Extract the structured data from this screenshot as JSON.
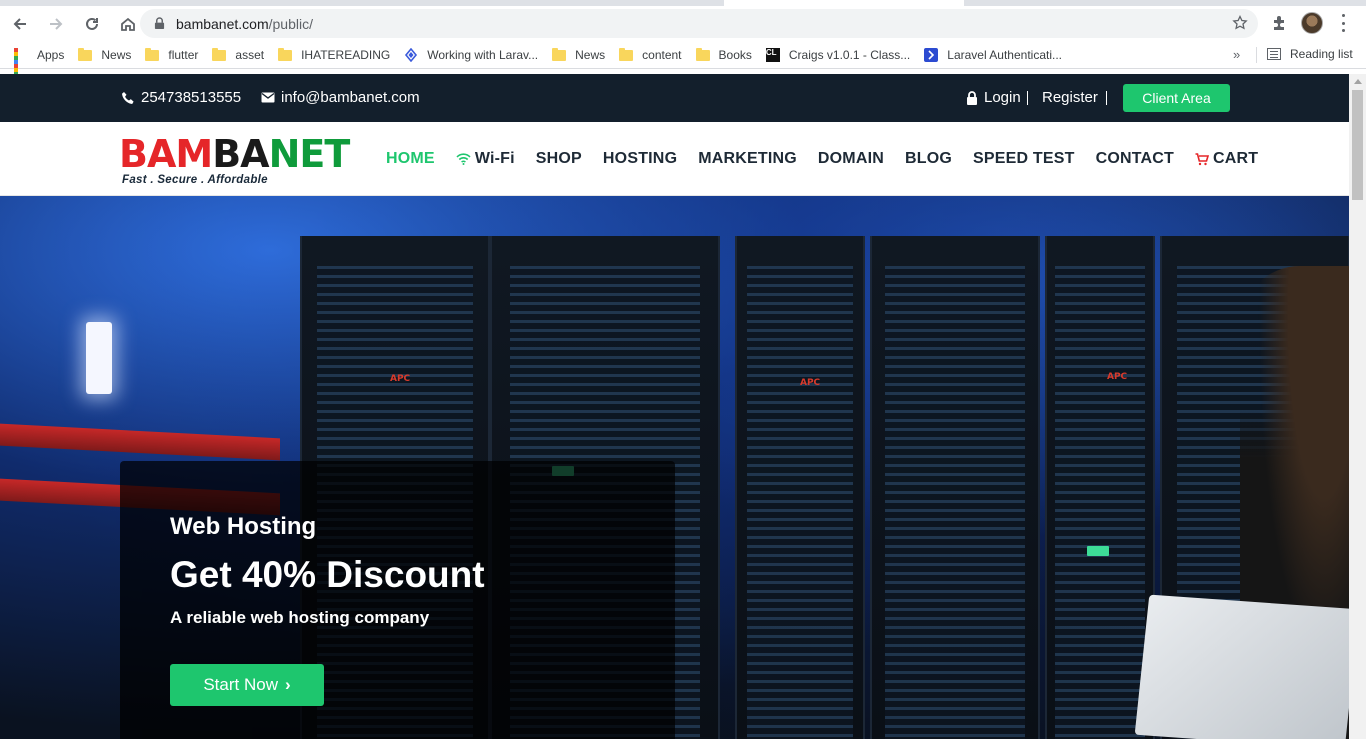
{
  "browser": {
    "url_host": "bambanet.com",
    "url_path": "/public/",
    "bookmarks": [
      {
        "label": "Apps",
        "icon": "apps-grid-icon"
      },
      {
        "label": "News",
        "icon": "folder-icon"
      },
      {
        "label": "flutter",
        "icon": "folder-icon"
      },
      {
        "label": "asset",
        "icon": "folder-icon"
      },
      {
        "label": "IHATEREADING",
        "icon": "folder-icon"
      },
      {
        "label": "Working with Larav...",
        "icon": "site-icon"
      },
      {
        "label": "News",
        "icon": "folder-icon"
      },
      {
        "label": "content",
        "icon": "folder-icon"
      },
      {
        "label": "Books",
        "icon": "folder-icon"
      },
      {
        "label": "Craigs v1.0.1 - Class...",
        "icon": "cl-icon"
      },
      {
        "label": "Laravel Authenticati...",
        "icon": "site-icon"
      }
    ],
    "more_bookmarks": "»",
    "reading_list": "Reading list"
  },
  "topbar": {
    "phone": "254738513555",
    "email": "info@bambanet.com",
    "login": "Login",
    "register": "Register",
    "client_area": "Client Area"
  },
  "logo": {
    "part1": "BAM",
    "part2": "BA",
    "part3": "NET",
    "tagline": "Fast . Secure .  Affordable"
  },
  "menu": {
    "home": "HOME",
    "wifi": "Wi-Fi",
    "shop": "SHOP",
    "hosting": "HOSTING",
    "marketing": "MARKETING",
    "domain": "DOMAIN",
    "blog": "BLOG",
    "speed_test": "SPEED TEST",
    "contact": "CONTACT",
    "cart": "CART"
  },
  "hero": {
    "eyebrow": "Web Hosting",
    "headline": "Get 40% Discount",
    "subtitle": "A reliable web hosting company",
    "cta": "Start Now",
    "rack_label": "APC"
  },
  "colors": {
    "accent_green": "#1ec66e",
    "topbar_bg": "#131f2c",
    "logo_red": "#e52629"
  }
}
